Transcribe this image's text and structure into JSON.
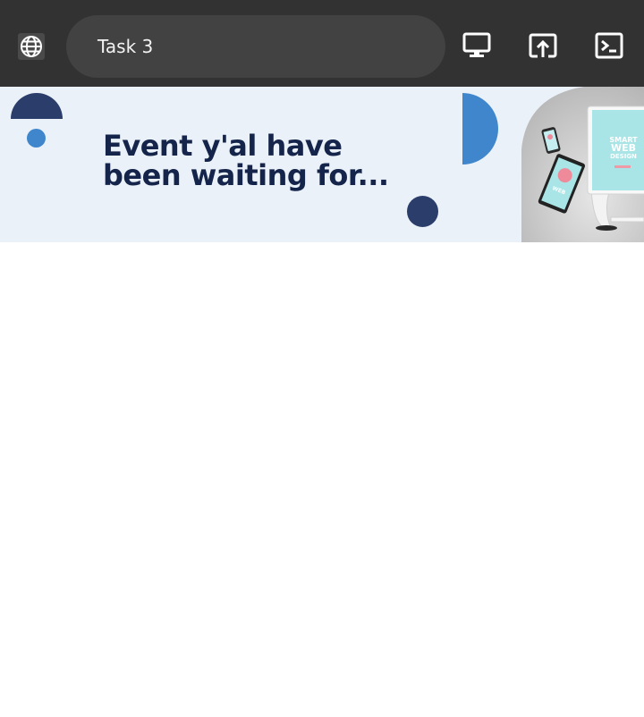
{
  "browser": {
    "tab_title": "Task 3",
    "icons": {
      "site": "globe-icon",
      "desktop": "monitor-icon",
      "open_external": "open-in-new-icon",
      "terminal": "terminal-icon"
    }
  },
  "banner": {
    "headline_line1": "Event y'al have",
    "headline_line2": "been waiting for...",
    "device_screen_text": [
      "SMART",
      "WEB",
      "DESIGN"
    ],
    "colors": {
      "background": "#eaf1f8",
      "navy": "#2b3d6b",
      "blue": "#3f86cc",
      "headline": "#15244a"
    }
  }
}
